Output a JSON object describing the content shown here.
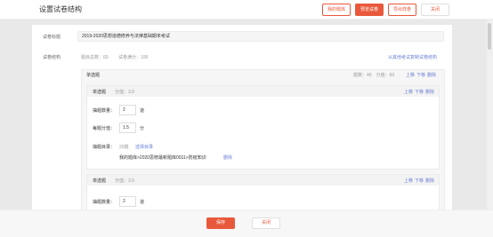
{
  "header": {
    "title": "设置试卷结构",
    "buttons": [
      "我的题库",
      "预览试卷",
      "导出样卷",
      "关闭"
    ]
  },
  "paper": {
    "title_label": "试卷标题",
    "title_value": "2019-2020思想道德修养与法律基础期末考试",
    "structure_label": "试卷结构",
    "total_questions": "题目总数：60",
    "total_score": "试卷满分：100",
    "copy_link": "从其他考试复制试卷结构"
  },
  "section": {
    "name": "单选题",
    "stats": "题数：40　分值：60",
    "actions": [
      "上移",
      "下移",
      "删除"
    ]
  },
  "items": [
    {
      "type": "单选题",
      "score_hint": "分值：3.0",
      "actions": [
        "上移",
        "下移",
        "删除"
      ],
      "count_label": "抽题数量：",
      "count_value": "2",
      "count_unit": "道",
      "per_label": "每题分值：",
      "per_value": "1.5",
      "per_unit": "分",
      "dir_label": "抽题目录：",
      "dir_count": "20题",
      "dir_select": "选择目录",
      "dir_path": "我的题库>2020思修最新题库0911>防疫知识",
      "dir_delete": "删除"
    },
    {
      "type": "单选题",
      "score_hint": "分值：3.0",
      "actions": [
        "上移",
        "下移",
        "删除"
      ],
      "count_label": "抽题数量：",
      "count_value": "2",
      "count_unit": "道"
    }
  ],
  "footer": {
    "save": "保存",
    "close": "关闭"
  },
  "colors": {
    "accent": "#e8593b",
    "link": "#6b7fd6"
  }
}
